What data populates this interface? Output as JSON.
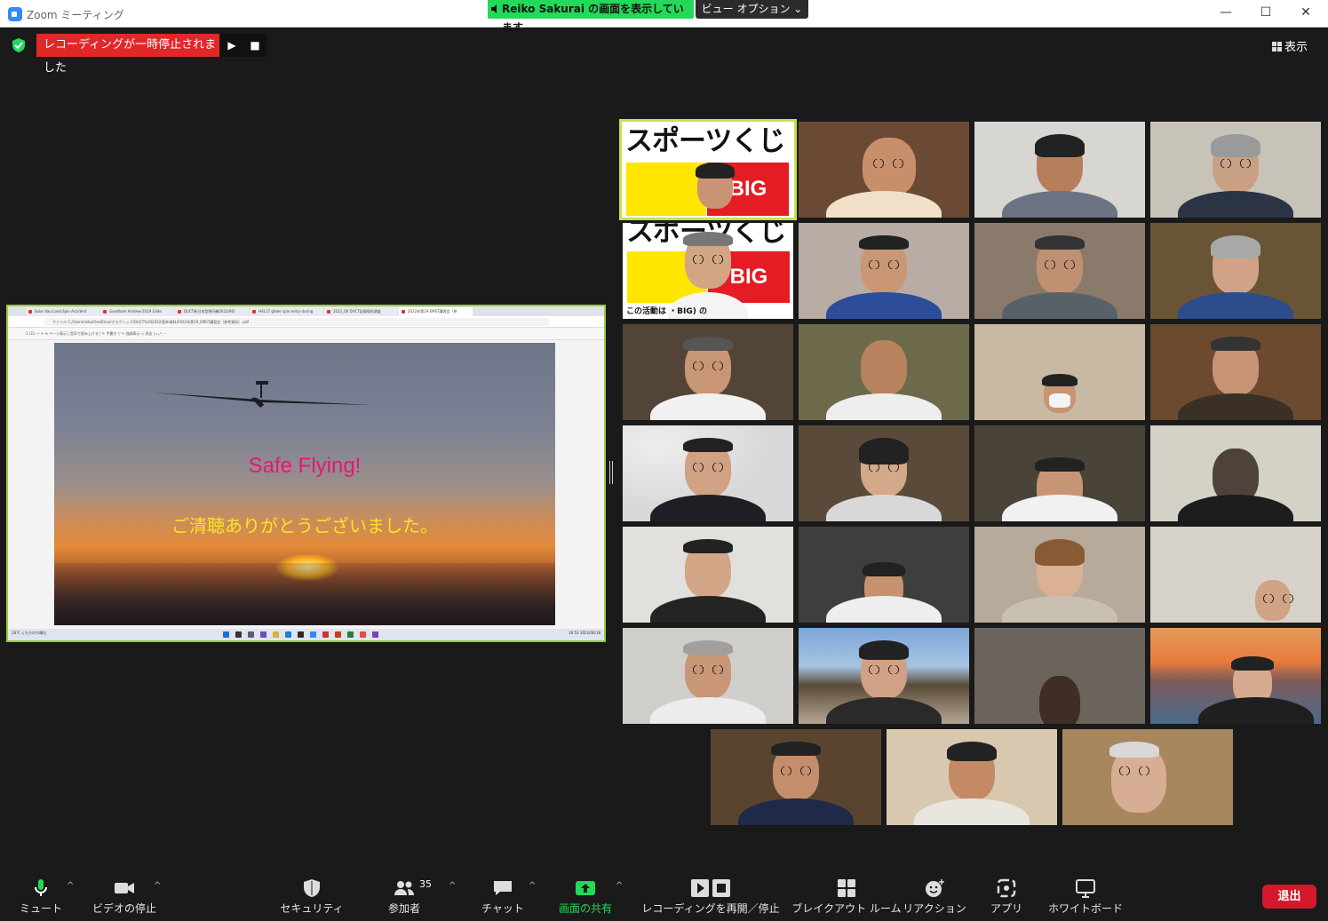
{
  "window": {
    "title": "Zoom ミーティング",
    "share_banner": "Reiko  Sakurai の画面を表示しています",
    "view_options": "ビュー オプション ⌄",
    "controls": {
      "minimize": "—",
      "maximize": "☐",
      "close": "✕"
    }
  },
  "topbar": {
    "recording_status": "レコーディングが一時停止されました",
    "resume_symbol": "▶",
    "stop_symbol": "■",
    "view_label": "表示"
  },
  "shared_screen": {
    "browser_tabs": [
      "Solar Vau Land Spin Accident",
      "Goodham Andrew 2019 Glide",
      "DUCT新日本型飛行機2022/06/",
      "HAL17 glider spin entry during",
      "2022_06 DUCT記録保存調査",
      "2022年第19 EMST講習会（参"
    ],
    "address": "ファイル    C:/Users/reiko/OneDrive/デスクトップ/DUCT%202022/配布資料/2022年第19_EMST講習会（参考資料）.pdf",
    "pdf_toolbar": "1  /31    —  +   ⟲    ページ表示   |   音声で読み上げる   |   ✎ 手書き   ▽   ✎ 強調表示   ◇   消去   |   ⌕   ⤢   ⋯",
    "slide_title": "Safe Flying!",
    "slide_subtitle": "ご清聴ありがとうございました。",
    "taskbar_left": "28°C  くもりのち晴れ",
    "taskbar_right": "16:53  2022/06/18"
  },
  "gallery": {
    "toto_text": "スポーツくじ",
    "big_text": "BIG",
    "toto_caption": "この活動は   ・BIG) の"
  },
  "toolbar": {
    "mute": "ミュート",
    "stop_video": "ビデオの停止",
    "security": "セキュリティ",
    "participants": "参加者",
    "participants_count": "35",
    "chat": "チャット",
    "share_screen": "画面の共有",
    "recording": "レコーディングを再開／停止",
    "breakout": "ブレイクアウト ルーム",
    "reactions": "リアクション",
    "apps": "アプリ",
    "whiteboard": "ホワイトボード",
    "leave": "退出",
    "caret": "^"
  },
  "colors": {
    "accent_green": "#23d959",
    "record_red": "#e02828",
    "leave_red": "#d4192c",
    "active_speaker": "#c8e04a",
    "background": "#1a1a1a"
  }
}
